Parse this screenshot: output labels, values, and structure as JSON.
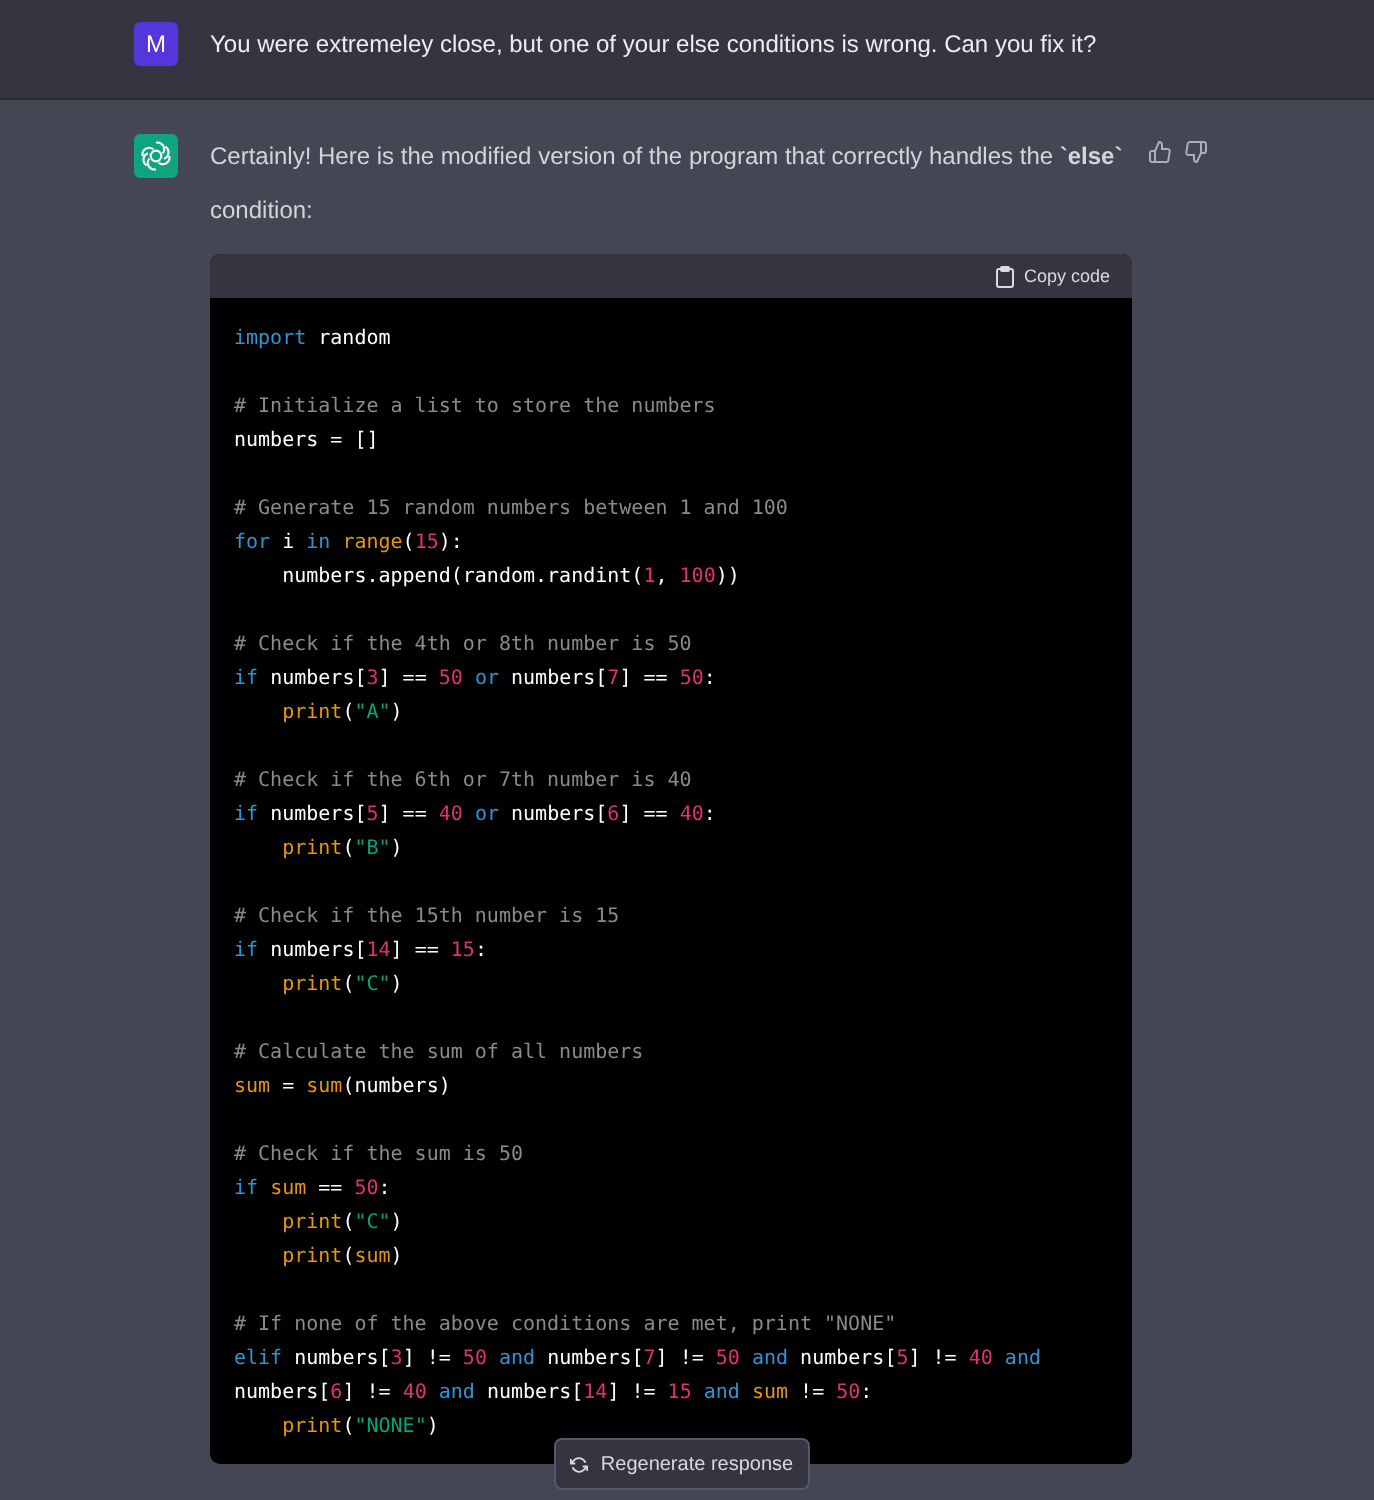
{
  "user_message": {
    "avatar": "M",
    "text": "You were extremeley close, but one of your else conditions is wrong. Can you fix it?"
  },
  "assistant_message": {
    "text": "Certainly! Here is the modified version of the program that correctly handles the **`else`** condition:"
  },
  "code_block": {
    "copy_label": "Copy code",
    "lines": [
      {
        "kind": "code",
        "indented": false,
        "tokens": [
          {
            "kind": "keyword",
            "text": "import"
          },
          {
            "kind": "plain",
            "text": " random"
          }
        ]
      },
      {
        "kind": "blank"
      },
      {
        "kind": "code",
        "indented": false,
        "tokens": [
          {
            "kind": "comment",
            "text": "# Initialize a list to store the numbers"
          }
        ]
      },
      {
        "kind": "code",
        "indented": false,
        "tokens": [
          {
            "kind": "plain",
            "text": "numbers = []"
          }
        ]
      },
      {
        "kind": "blank"
      },
      {
        "kind": "code",
        "indented": false,
        "tokens": [
          {
            "kind": "comment",
            "text": "# Generate 15 random numbers between 1 and 100"
          }
        ]
      },
      {
        "kind": "code",
        "indented": false,
        "tokens": [
          {
            "kind": "keyword",
            "text": "for"
          },
          {
            "kind": "plain",
            "text": " i "
          },
          {
            "kind": "keyword",
            "text": "in"
          },
          {
            "kind": "builtin",
            "text": " range"
          },
          {
            "kind": "plain",
            "text": "("
          },
          {
            "kind": "number",
            "text": "15"
          },
          {
            "kind": "plain",
            "text": "):"
          }
        ]
      },
      {
        "kind": "code",
        "indented": true,
        "tokens": [
          {
            "kind": "plain",
            "text": "numbers.append(random.randint("
          },
          {
            "kind": "number",
            "text": "1"
          },
          {
            "kind": "plain",
            "text": ", "
          },
          {
            "kind": "number",
            "text": "100"
          },
          {
            "kind": "plain",
            "text": "))"
          }
        ]
      },
      {
        "kind": "blank"
      },
      {
        "kind": "code",
        "indented": false,
        "tokens": [
          {
            "kind": "comment",
            "text": "# Check if the 4th or 8th number is 50"
          }
        ]
      },
      {
        "kind": "code",
        "indented": false,
        "tokens": [
          {
            "kind": "keyword",
            "text": "if"
          },
          {
            "kind": "plain",
            "text": " numbers["
          },
          {
            "kind": "number",
            "text": "3"
          },
          {
            "kind": "plain",
            "text": "] == "
          },
          {
            "kind": "number",
            "text": "50"
          },
          {
            "kind": "keyword",
            "text": " or"
          },
          {
            "kind": "plain",
            "text": " numbers["
          },
          {
            "kind": "number",
            "text": "7"
          },
          {
            "kind": "plain",
            "text": "] == "
          },
          {
            "kind": "number",
            "text": "50"
          },
          {
            "kind": "plain",
            "text": ":"
          }
        ]
      },
      {
        "kind": "code",
        "indented": true,
        "tokens": [
          {
            "kind": "builtin",
            "text": "print"
          },
          {
            "kind": "plain",
            "text": "("
          },
          {
            "kind": "string",
            "text": "\"A\""
          },
          {
            "kind": "plain",
            "text": ")"
          }
        ]
      },
      {
        "kind": "blank"
      },
      {
        "kind": "code",
        "indented": false,
        "tokens": [
          {
            "kind": "comment",
            "text": "# Check if the 6th or 7th number is 40"
          }
        ]
      },
      {
        "kind": "code",
        "indented": false,
        "tokens": [
          {
            "kind": "keyword",
            "text": "if"
          },
          {
            "kind": "plain",
            "text": " numbers["
          },
          {
            "kind": "number",
            "text": "5"
          },
          {
            "kind": "plain",
            "text": "] == "
          },
          {
            "kind": "number",
            "text": "40"
          },
          {
            "kind": "keyword",
            "text": " or"
          },
          {
            "kind": "plain",
            "text": " numbers["
          },
          {
            "kind": "number",
            "text": "6"
          },
          {
            "kind": "plain",
            "text": "] == "
          },
          {
            "kind": "number",
            "text": "40"
          },
          {
            "kind": "plain",
            "text": ":"
          }
        ]
      },
      {
        "kind": "code",
        "indented": true,
        "tokens": [
          {
            "kind": "builtin",
            "text": "print"
          },
          {
            "kind": "plain",
            "text": "("
          },
          {
            "kind": "string",
            "text": "\"B\""
          },
          {
            "kind": "plain",
            "text": ")"
          }
        ]
      },
      {
        "kind": "blank"
      },
      {
        "kind": "code",
        "indented": false,
        "tokens": [
          {
            "kind": "comment",
            "text": "# Check if the 15th number is 15"
          }
        ]
      },
      {
        "kind": "code",
        "indented": false,
        "tokens": [
          {
            "kind": "keyword",
            "text": "if"
          },
          {
            "kind": "plain",
            "text": " numbers["
          },
          {
            "kind": "number",
            "text": "14"
          },
          {
            "kind": "plain",
            "text": "] == "
          },
          {
            "kind": "number",
            "text": "15"
          },
          {
            "kind": "plain",
            "text": ":"
          }
        ]
      },
      {
        "kind": "code",
        "indented": true,
        "tokens": [
          {
            "kind": "builtin",
            "text": "print"
          },
          {
            "kind": "plain",
            "text": "("
          },
          {
            "kind": "string",
            "text": "\"C\""
          },
          {
            "kind": "plain",
            "text": ")"
          }
        ]
      },
      {
        "kind": "blank"
      },
      {
        "kind": "code",
        "indented": false,
        "tokens": [
          {
            "kind": "comment",
            "text": "# Calculate the sum of all numbers"
          }
        ]
      },
      {
        "kind": "code",
        "indented": false,
        "tokens": [
          {
            "kind": "builtin",
            "text": "sum"
          },
          {
            "kind": "plain",
            "text": " = "
          },
          {
            "kind": "builtin",
            "text": "sum"
          },
          {
            "kind": "plain",
            "text": "(numbers)"
          }
        ]
      },
      {
        "kind": "blank"
      },
      {
        "kind": "code",
        "indented": false,
        "tokens": [
          {
            "kind": "comment",
            "text": "# Check if the sum is 50"
          }
        ]
      },
      {
        "kind": "code",
        "indented": false,
        "tokens": [
          {
            "kind": "keyword",
            "text": "if"
          },
          {
            "kind": "builtin",
            "text": " sum"
          },
          {
            "kind": "plain",
            "text": " == "
          },
          {
            "kind": "number",
            "text": "50"
          },
          {
            "kind": "plain",
            "text": ":"
          }
        ]
      },
      {
        "kind": "code",
        "indented": true,
        "tokens": [
          {
            "kind": "builtin",
            "text": "print"
          },
          {
            "kind": "plain",
            "text": "("
          },
          {
            "kind": "string",
            "text": "\"C\""
          },
          {
            "kind": "plain",
            "text": ")"
          }
        ]
      },
      {
        "kind": "code",
        "indented": true,
        "tokens": [
          {
            "kind": "builtin",
            "text": "print"
          },
          {
            "kind": "plain",
            "text": "("
          },
          {
            "kind": "builtin",
            "text": "sum"
          },
          {
            "kind": "plain",
            "text": ")"
          }
        ]
      },
      {
        "kind": "blank"
      },
      {
        "kind": "code",
        "indented": false,
        "tokens": [
          {
            "kind": "comment",
            "text": "# If none of the above conditions are met, print \"NONE\""
          }
        ]
      },
      {
        "kind": "code",
        "indented": false,
        "tokens": [
          {
            "kind": "keyword",
            "text": "elif"
          },
          {
            "kind": "plain",
            "text": " numbers["
          },
          {
            "kind": "number",
            "text": "3"
          },
          {
            "kind": "plain",
            "text": "] != "
          },
          {
            "kind": "number",
            "text": "50"
          },
          {
            "kind": "keyword",
            "text": " and"
          },
          {
            "kind": "plain",
            "text": " numbers["
          },
          {
            "kind": "number",
            "text": "7"
          },
          {
            "kind": "plain",
            "text": "] != "
          },
          {
            "kind": "number",
            "text": "50"
          },
          {
            "kind": "keyword",
            "text": " and"
          },
          {
            "kind": "plain",
            "text": " numbers["
          },
          {
            "kind": "number",
            "text": "5"
          },
          {
            "kind": "plain",
            "text": "] != "
          },
          {
            "kind": "number",
            "text": "40"
          },
          {
            "kind": "keyword",
            "text": " and"
          }
        ]
      },
      {
        "kind": "code",
        "indented": false,
        "tokens": [
          {
            "kind": "plain",
            "text": "numbers["
          },
          {
            "kind": "number",
            "text": "6"
          },
          {
            "kind": "plain",
            "text": "] != "
          },
          {
            "kind": "number",
            "text": "40"
          },
          {
            "kind": "keyword",
            "text": " and"
          },
          {
            "kind": "plain",
            "text": " numbers["
          },
          {
            "kind": "number",
            "text": "14"
          },
          {
            "kind": "plain",
            "text": "] != "
          },
          {
            "kind": "number",
            "text": "15"
          },
          {
            "kind": "keyword",
            "text": " and"
          },
          {
            "kind": "builtin",
            "text": " sum"
          },
          {
            "kind": "plain",
            "text": " != "
          },
          {
            "kind": "number",
            "text": "50"
          },
          {
            "kind": "plain",
            "text": ":"
          }
        ]
      },
      {
        "kind": "code",
        "indented": true,
        "tokens": [
          {
            "kind": "builtin",
            "text": "print"
          },
          {
            "kind": "plain",
            "text": "("
          },
          {
            "kind": "string",
            "text": "\"NONE\""
          },
          {
            "kind": "plain",
            "text": ")"
          }
        ]
      }
    ]
  },
  "regenerate_button": {
    "label": "Regenerate response"
  }
}
